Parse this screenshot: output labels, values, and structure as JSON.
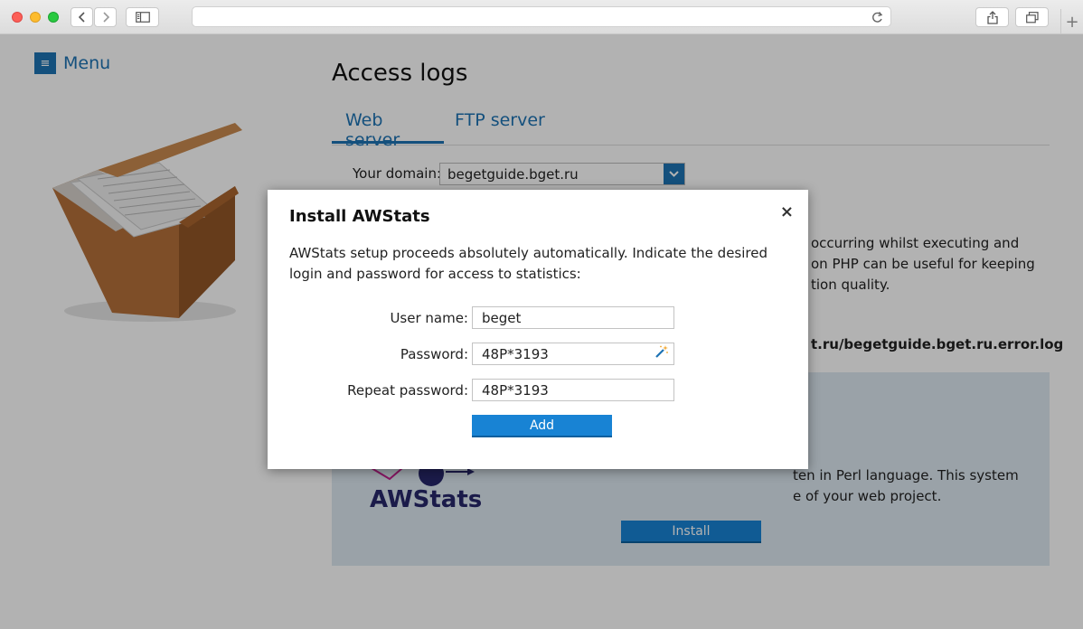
{
  "browser": {
    "icons": [
      "back-icon",
      "forward-icon",
      "sidebar-icon",
      "reload-icon",
      "share-icon",
      "tabs-icon",
      "new-tab-icon"
    ],
    "new_tab_glyph": "+"
  },
  "page": {
    "menu_label": "Menu",
    "menu_glyph": "≡",
    "title": "Access logs",
    "tabs": [
      {
        "label": "Web server",
        "active": true
      },
      {
        "label": "FTP server",
        "active": false
      }
    ],
    "domain_label": "Your domain:",
    "domain_value": "begetguide.bget.ru",
    "php_text": [
      "occurring whilst executing and",
      "on PHP can be useful for keeping",
      "tion quality."
    ],
    "log_path": "t.ru/begetguide.bget.ru.error.log",
    "awstats_text": [
      "ten in Perl language. This system",
      "e of your web project."
    ],
    "awstats_logo": "AWStats",
    "install_label": "Install"
  },
  "modal": {
    "title": "Install AWStats",
    "close_glyph": "×",
    "description": "AWStats setup proceeds absolutely automatically. Indicate the desired login and password for access to statistics:",
    "fields": {
      "username": {
        "label": "User name:",
        "value": "beget"
      },
      "password": {
        "label": "Password:",
        "value": "48P*3193"
      },
      "repeat": {
        "label": "Repeat password:",
        "value": "48P*3193"
      }
    },
    "add_label": "Add"
  },
  "colors": {
    "accent": "#1d73b4",
    "button": "#1883d4",
    "panel": "#dde8f1"
  }
}
